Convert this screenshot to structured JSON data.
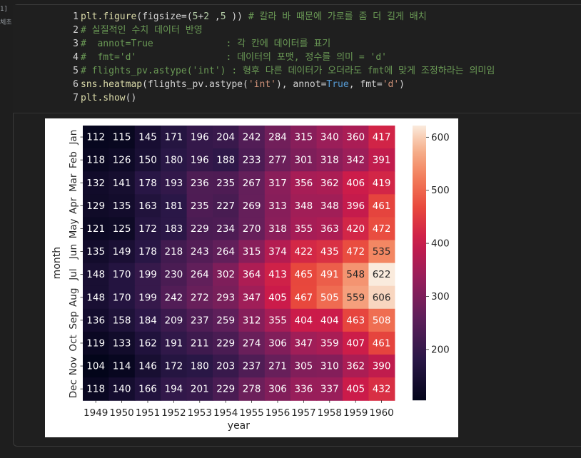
{
  "gutter": {
    "exec_label": "1]",
    "status_label": "체초"
  },
  "code": {
    "lines": [
      {
        "n": "1",
        "tokens": [
          {
            "c": "fn",
            "t": "plt.figure"
          },
          {
            "c": "txt",
            "t": "("
          },
          {
            "c": "txt",
            "t": "figsize"
          },
          {
            "c": "txt",
            "t": "=("
          },
          {
            "c": "num",
            "t": "5"
          },
          {
            "c": "txt",
            "t": "+"
          },
          {
            "c": "num",
            "t": "2"
          },
          {
            "c": "txt",
            "t": " ,"
          },
          {
            "c": "num",
            "t": "5"
          },
          {
            "c": "txt",
            "t": " )) "
          },
          {
            "c": "cmt",
            "t": "# 칼라 바 때문에 가로를 좀 더 길게 배치"
          }
        ]
      },
      {
        "n": "2",
        "tokens": [
          {
            "c": "cmt",
            "t": "# 실질적인 수치 데이터 반영"
          }
        ]
      },
      {
        "n": "3",
        "tokens": [
          {
            "c": "cmt",
            "t": "#  annot=True             : 각 칸에 데이터를 표기"
          }
        ]
      },
      {
        "n": "4",
        "tokens": [
          {
            "c": "cmt",
            "t": "#  fmt='d'                : 데이터의 포맷, 정수를 의미 = 'd'"
          }
        ]
      },
      {
        "n": "5",
        "tokens": [
          {
            "c": "cmt",
            "t": "# flights_pv.astype('int') : 형후 다른 데이터가 오더라도 fmt에 맞게 조정하라는 의미임"
          }
        ]
      },
      {
        "n": "6",
        "tokens": [
          {
            "c": "fn",
            "t": "sns.heatmap"
          },
          {
            "c": "txt",
            "t": "(flights_pv.astype("
          },
          {
            "c": "str",
            "t": "'int'"
          },
          {
            "c": "txt",
            "t": "), annot="
          },
          {
            "c": "kw",
            "t": "True"
          },
          {
            "c": "txt",
            "t": ", fmt="
          },
          {
            "c": "str",
            "t": "'d'"
          },
          {
            "c": "txt",
            "t": ")"
          }
        ]
      },
      {
        "n": "7",
        "tokens": [
          {
            "c": "fn",
            "t": "plt.show"
          },
          {
            "c": "txt",
            "t": "()"
          }
        ]
      }
    ]
  },
  "chart_data": {
    "type": "heatmap",
    "title": "",
    "xlabel": "year",
    "ylabel": "month",
    "x": [
      "1949",
      "1950",
      "1951",
      "1952",
      "1953",
      "1954",
      "1955",
      "1956",
      "1957",
      "1958",
      "1959",
      "1960"
    ],
    "y": [
      "Jan",
      "Feb",
      "Mar",
      "Apr",
      "May",
      "Jun",
      "Jul",
      "Aug",
      "Sep",
      "Oct",
      "Nov",
      "Dec"
    ],
    "values": [
      [
        112,
        115,
        145,
        171,
        196,
        204,
        242,
        284,
        315,
        340,
        360,
        417
      ],
      [
        118,
        126,
        150,
        180,
        196,
        188,
        233,
        277,
        301,
        318,
        342,
        391
      ],
      [
        132,
        141,
        178,
        193,
        236,
        235,
        267,
        317,
        356,
        362,
        406,
        419
      ],
      [
        129,
        135,
        163,
        181,
        235,
        227,
        269,
        313,
        348,
        348,
        396,
        461
      ],
      [
        121,
        125,
        172,
        183,
        229,
        234,
        270,
        318,
        355,
        363,
        420,
        472
      ],
      [
        135,
        149,
        178,
        218,
        243,
        264,
        315,
        374,
        422,
        435,
        472,
        535
      ],
      [
        148,
        170,
        199,
        230,
        264,
        302,
        364,
        413,
        465,
        491,
        548,
        622
      ],
      [
        148,
        170,
        199,
        242,
        272,
        293,
        347,
        405,
        467,
        505,
        559,
        606
      ],
      [
        136,
        158,
        184,
        209,
        237,
        259,
        312,
        355,
        404,
        404,
        463,
        508
      ],
      [
        119,
        133,
        162,
        191,
        211,
        229,
        274,
        306,
        347,
        359,
        407,
        461
      ],
      [
        104,
        114,
        146,
        172,
        180,
        203,
        237,
        271,
        305,
        310,
        362,
        390
      ],
      [
        118,
        140,
        166,
        194,
        201,
        229,
        278,
        306,
        336,
        337,
        405,
        432
      ]
    ],
    "vmin": 104,
    "vmax": 622,
    "colorbar_ticks": [
      200,
      300,
      400,
      500,
      600
    ],
    "colormap": "rocket",
    "annot": true,
    "fmt": "d"
  }
}
